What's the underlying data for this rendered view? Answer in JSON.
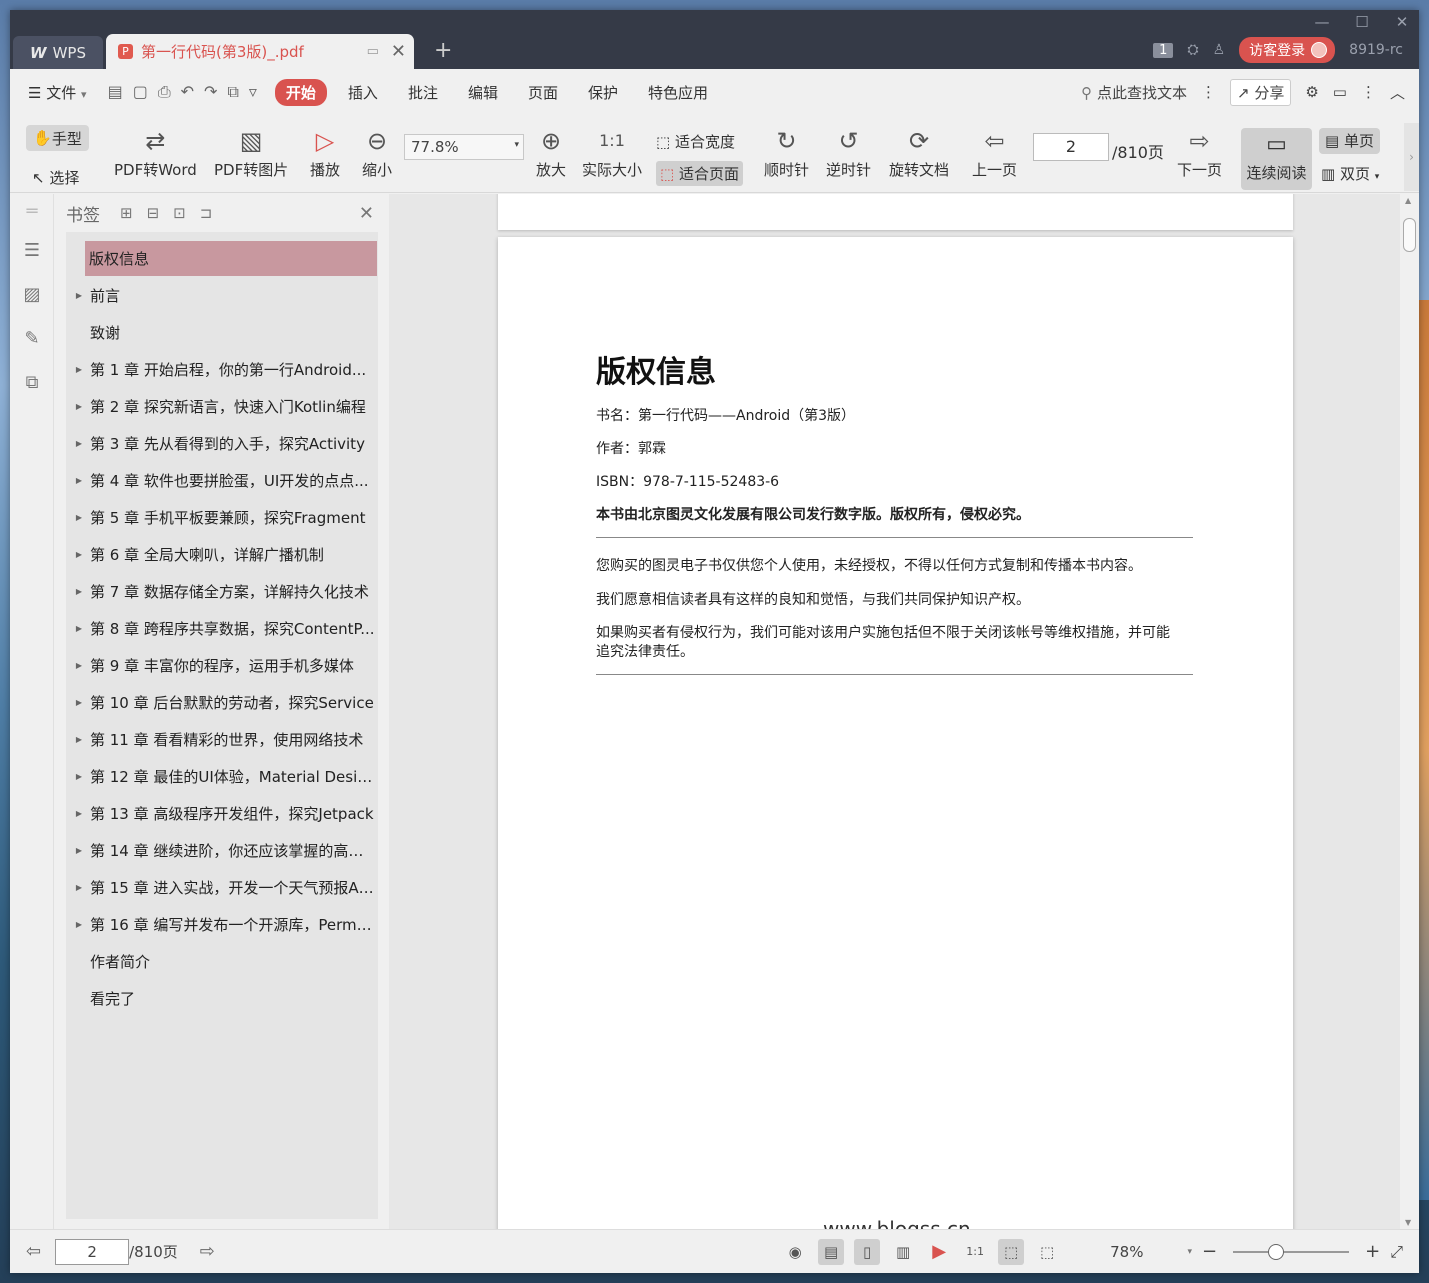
{
  "window_controls": [
    "—",
    "☐",
    "✕"
  ],
  "tabs": {
    "wps_label": "WPS",
    "doc_title": "第一行代码(第3版)_.pdf"
  },
  "title_right": {
    "count_badge": "1",
    "login_label": "访客登录",
    "version_text": "8919-rc"
  },
  "menu": {
    "file": "文件",
    "items": [
      "开始",
      "插入",
      "批注",
      "编辑",
      "页面",
      "保护",
      "特色应用"
    ],
    "search_placeholder": "点此查找文本",
    "share_label": "分享"
  },
  "ribbon": {
    "hand": "手型",
    "select": "选择",
    "pdf_to_word": "PDF转Word",
    "pdf_to_image": "PDF转图片",
    "play": "播放",
    "zoom_out": "缩小",
    "zoom_value": "77.8%",
    "zoom_in": "放大",
    "actual_size": "实际大小",
    "fit_width": "适合宽度",
    "fit_page": "适合页面",
    "rotate_cw": "顺时针",
    "rotate_ccw": "逆时针",
    "rotate_doc": "旋转文档",
    "prev_page": "上一页",
    "current_page": "2",
    "total_pages": "/810页",
    "next_page": "下一页",
    "continuous": "连续阅读",
    "single": "单页",
    "double": "双页"
  },
  "bookmarks": {
    "title": "书签",
    "items": [
      {
        "label": "版权信息",
        "expandable": false,
        "selected": true
      },
      {
        "label": "前言",
        "expandable": true
      },
      {
        "label": "致谢",
        "expandable": false
      },
      {
        "label": "第 1 章 开始启程，你的第一行Android...",
        "expandable": true
      },
      {
        "label": "第 2 章 探究新语言，快速入门Kotlin编程",
        "expandable": true
      },
      {
        "label": "第 3 章 先从看得到的入手，探究Activity",
        "expandable": true
      },
      {
        "label": "第 4 章 软件也要拼脸蛋，UI开发的点点...",
        "expandable": true
      },
      {
        "label": "第 5 章 手机平板要兼顾，探究Fragment",
        "expandable": true
      },
      {
        "label": "第 6 章 全局大喇叭，详解广播机制",
        "expandable": true
      },
      {
        "label": "第 7 章 数据存储全方案，详解持久化技术",
        "expandable": true
      },
      {
        "label": "第 8 章 跨程序共享数据，探究ContentP...",
        "expandable": true
      },
      {
        "label": "第 9 章 丰富你的程序，运用手机多媒体",
        "expandable": true
      },
      {
        "label": "第 10 章 后台默默的劳动者，探究Service",
        "expandable": true
      },
      {
        "label": "第 11 章 看看精彩的世界，使用网络技术",
        "expandable": true
      },
      {
        "label": "第 12 章 最佳的UI体验，Material Desig...",
        "expandable": true
      },
      {
        "label": "第 13 章 高级程序开发组件，探究Jetpack",
        "expandable": true
      },
      {
        "label": "第 14 章 继续进阶，你还应该掌握的高级...",
        "expandable": true
      },
      {
        "label": "第 15 章 进入实战，开发一个天气预报App",
        "expandable": true
      },
      {
        "label": "第 16 章 编写并发布一个开源库，Permi...",
        "expandable": true
      },
      {
        "label": "作者简介",
        "expandable": false
      },
      {
        "label": "看完了",
        "expandable": false
      }
    ]
  },
  "page": {
    "heading": "版权信息",
    "book_name": "书名：第一行代码——Android（第3版）",
    "author": "作者：郭霖",
    "isbn": "ISBN：978-7-115-52483-6",
    "publisher_note": "本书由北京图灵文化发展有限公司发行数字版。版权所有，侵权必究。",
    "p1": "您购买的图灵电子书仅供您个人使用，未经授权，不得以任何方式复制和传播本书内容。",
    "p2": "我们愿意相信读者具有这样的良知和觉悟，与我们共同保护知识产权。",
    "p3a": "如果购买者有侵权行为，我们可能对该用户实施包括但不限于关闭该帐号等维权措施，并可能",
    "p3b": "追究法律责任。",
    "watermark": "www.blogss.cn"
  },
  "status": {
    "page_input": "2",
    "total": "/810页",
    "zoom": "78%"
  }
}
